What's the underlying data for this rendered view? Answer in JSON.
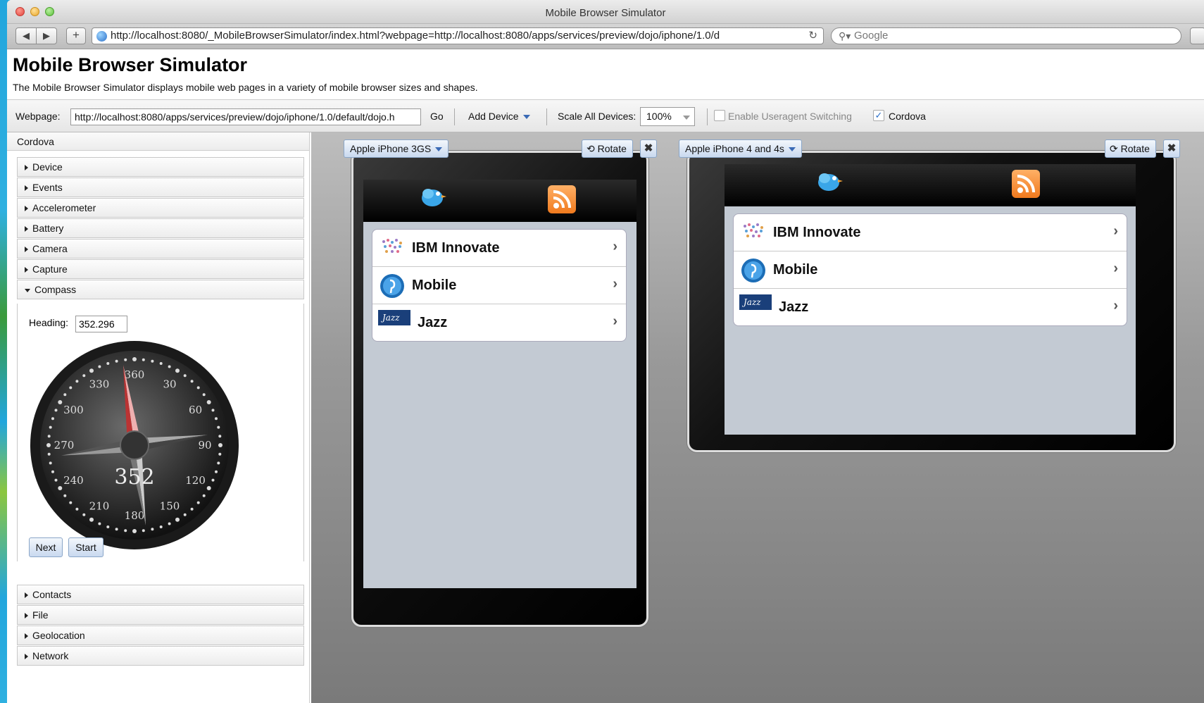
{
  "browser": {
    "window_title": "Mobile Browser Simulator",
    "url": "http://localhost:8080/_MobileBrowserSimulator/index.html?webpage=http://localhost:8080/apps/services/preview/dojo/iphone/1.0/d",
    "search_placeholder": "Google"
  },
  "header": {
    "title": "Mobile Browser Simulator",
    "description": "The Mobile Browser Simulator displays mobile web pages in a variety of mobile browser sizes and shapes."
  },
  "options": {
    "webpage_label": "Webpage:",
    "webpage_value": "http://localhost:8080/apps/services/preview/dojo/iphone/1.0/default/dojo.h",
    "go_label": "Go",
    "add_device_label": "Add Device",
    "scale_label": "Scale All Devices:",
    "scale_value": "100%",
    "useragent_label": "Enable Useragent Switching",
    "useragent_checked": false,
    "cordova_label": "Cordova",
    "cordova_checked": true
  },
  "sidebar": {
    "title": "Cordova",
    "sections_top": [
      "Device",
      "Events",
      "Accelerometer",
      "Battery",
      "Camera",
      "Capture"
    ],
    "compass": {
      "label": "Compass",
      "heading_label": "Heading:",
      "heading_value": "352.296",
      "dial_readout": "352",
      "dial_ticks": [
        "360",
        "30",
        "60",
        "90",
        "120",
        "150",
        "180",
        "210",
        "240",
        "270",
        "300",
        "330"
      ],
      "next_label": "Next",
      "start_label": "Start"
    },
    "sections_bottom": [
      "Contacts",
      "File",
      "Geolocation",
      "Network"
    ]
  },
  "devices": [
    {
      "name": "Apple iPhone 3GS",
      "rotate_label": "Rotate",
      "close_label": "✖",
      "list": [
        "IBM Innovate",
        "Mobile",
        "Jazz"
      ]
    },
    {
      "name": "Apple iPhone 4 and 4s",
      "rotate_label": "Rotate",
      "close_label": "✖",
      "list": [
        "IBM Innovate",
        "Mobile",
        "Jazz"
      ]
    }
  ],
  "icons": {
    "jazz_logo_text": "Jazz"
  }
}
